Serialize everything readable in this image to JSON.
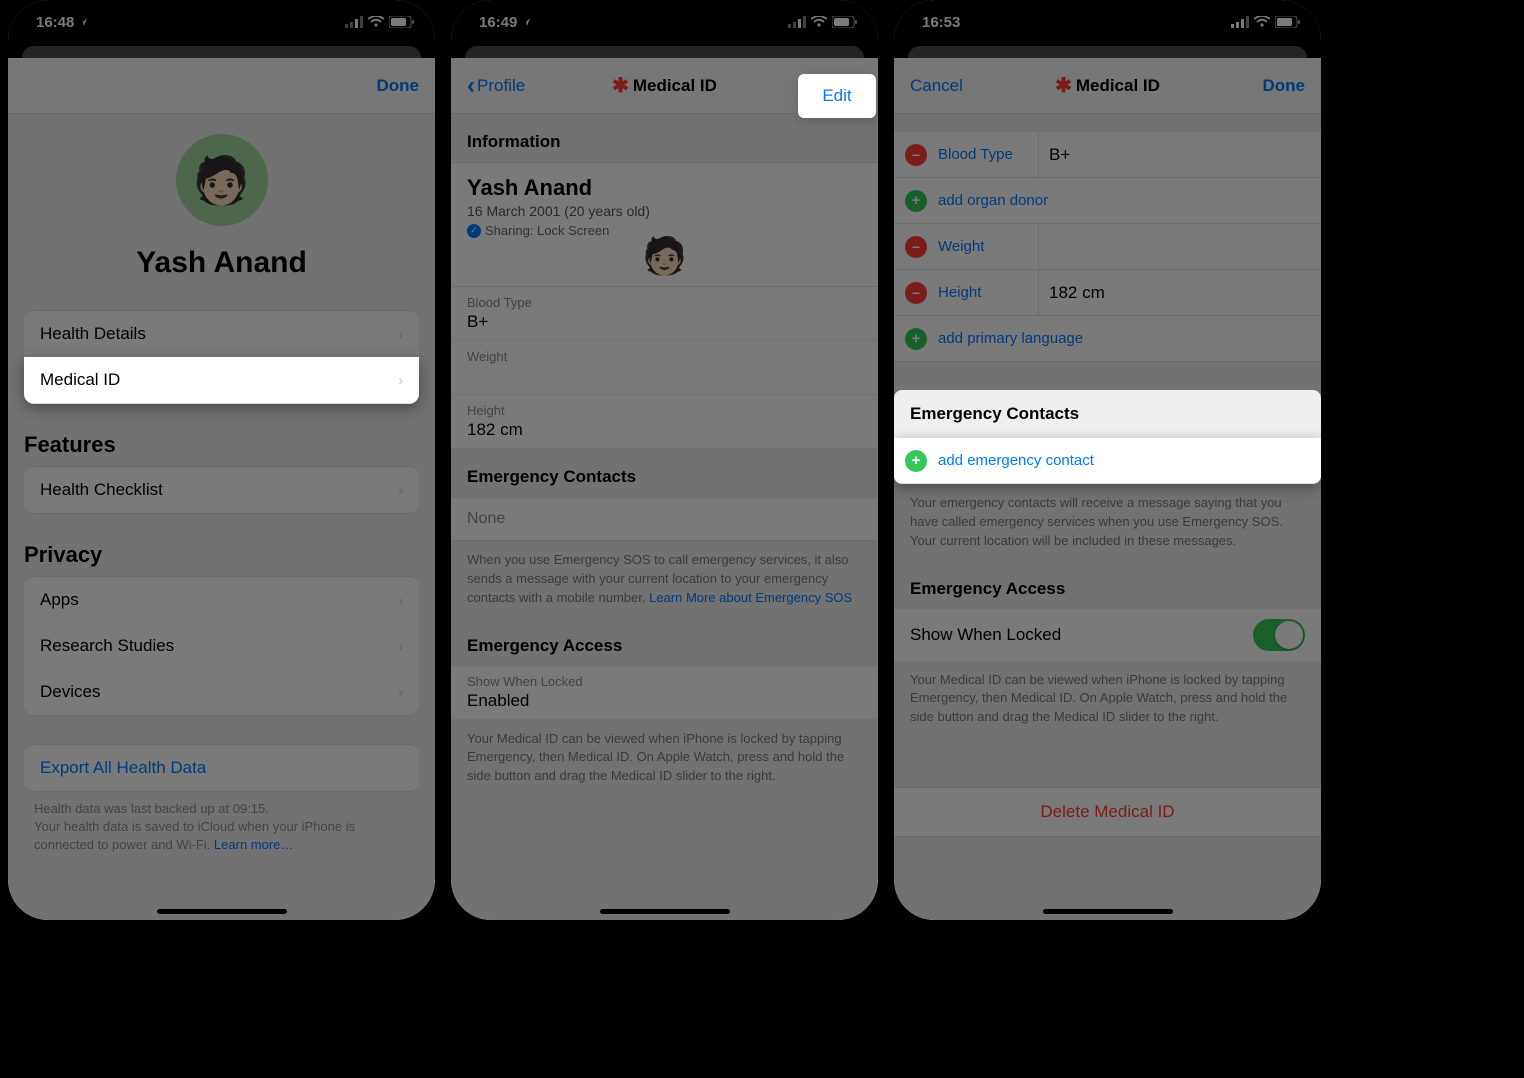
{
  "s1": {
    "time": "16:48",
    "done": "Done",
    "profile_name": "Yash Anand",
    "rows": {
      "health_details": "Health Details",
      "medical_id": "Medical ID",
      "features_hdr": "Features",
      "health_checklist": "Health Checklist",
      "privacy_hdr": "Privacy",
      "apps": "Apps",
      "research": "Research Studies",
      "devices": "Devices",
      "export": "Export All Health Data"
    },
    "footer1": "Health data was last backed up at 09:15.",
    "footer2": "Your health data is saved to iCloud when your iPhone is connected to power and Wi-Fi. ",
    "learn_more": "Learn more…"
  },
  "s2": {
    "time": "16:49",
    "back": "Profile",
    "title": "Medical ID",
    "edit": "Edit",
    "info_hdr": "Information",
    "name": "Yash Anand",
    "dob": "16 March 2001 (20 years old)",
    "sharing": "Sharing: Lock Screen",
    "blood_k": "Blood Type",
    "blood_v": "B+",
    "weight_k": "Weight",
    "height_k": "Height",
    "height_v": "182 cm",
    "ec_hdr": "Emergency Contacts",
    "ec_none": "None",
    "ec_footer": "When you use Emergency SOS to call emergency services, it also sends a message with your current location to your emergency contacts with a mobile number. ",
    "ec_link": "Learn More about Emergency SOS",
    "ea_hdr": "Emergency Access",
    "swl_k": "Show When Locked",
    "swl_v": "Enabled",
    "ea_footer": "Your Medical ID can be viewed when iPhone is locked by tapping Emergency, then Medical ID. On Apple Watch, press and hold the side button and drag the Medical ID slider to the right."
  },
  "s3": {
    "time": "16:53",
    "cancel": "Cancel",
    "title": "Medical ID",
    "done": "Done",
    "rows": {
      "blood": {
        "label": "Blood Type",
        "value": "B+"
      },
      "organ": "add organ donor",
      "weight": {
        "label": "Weight",
        "value": ""
      },
      "height": {
        "label": "Height",
        "value": "182 cm"
      },
      "primary_lang": "add primary language"
    },
    "ec_hdr": "Emergency Contacts",
    "add_ec": "add emergency contact",
    "ec_footer": "Your emergency contacts will receive a message saying that you have called emergency services when you use Emergency SOS. Your current location will be included in these messages.",
    "ea_hdr": "Emergency Access",
    "swl": "Show When Locked",
    "ea_footer": "Your Medical ID can be viewed when iPhone is locked by tapping Emergency, then Medical ID. On Apple Watch, press and hold the side button and drag the Medical ID slider to the right.",
    "delete": "Delete Medical ID"
  }
}
